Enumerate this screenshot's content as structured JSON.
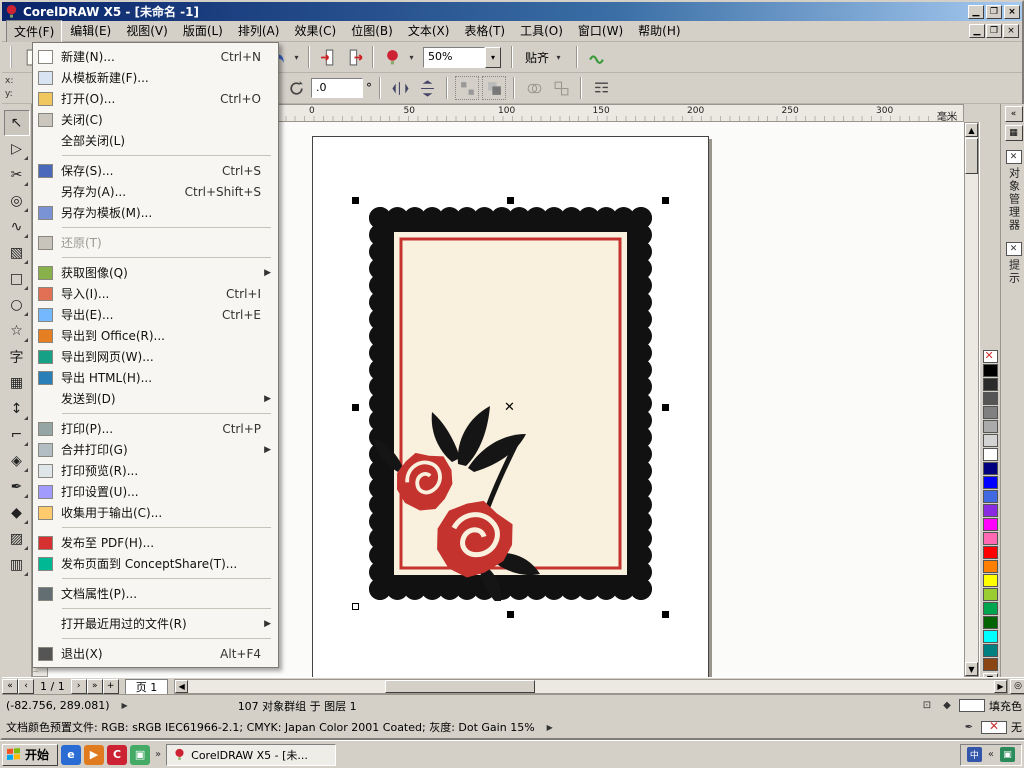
{
  "window": {
    "title": "CorelDRAW X5 - [未命名 -1]"
  },
  "menubar": {
    "items": [
      "文件(F)",
      "编辑(E)",
      "视图(V)",
      "版面(L)",
      "排列(A)",
      "效果(C)",
      "位图(B)",
      "文本(X)",
      "表格(T)",
      "工具(O)",
      "窗口(W)",
      "帮助(H)"
    ]
  },
  "file_menu": {
    "items": [
      {
        "label": "新建(N)...",
        "shortcut": "Ctrl+N",
        "icon": "new-doc-icon"
      },
      {
        "label": "从模板新建(F)...",
        "icon": "new-from-template-icon"
      },
      {
        "label": "打开(O)...",
        "shortcut": "Ctrl+O",
        "icon": "open-folder-icon"
      },
      {
        "label": "关闭(C)",
        "icon": "close-doc-icon"
      },
      {
        "label": "全部关闭(L)"
      },
      {
        "type": "separator"
      },
      {
        "label": "保存(S)...",
        "shortcut": "Ctrl+S",
        "icon": "save-icon"
      },
      {
        "label": "另存为(A)...",
        "shortcut": "Ctrl+Shift+S"
      },
      {
        "label": "另存为模板(M)...",
        "icon": "save-template-icon"
      },
      {
        "type": "separator"
      },
      {
        "label": "还原(T)",
        "disabled": true,
        "icon": "revert-icon"
      },
      {
        "type": "separator"
      },
      {
        "label": "获取图像(Q)",
        "submenu": true,
        "icon": "acquire-image-icon"
      },
      {
        "label": "导入(I)...",
        "shortcut": "Ctrl+I",
        "icon": "import-icon"
      },
      {
        "label": "导出(E)...",
        "shortcut": "Ctrl+E",
        "icon": "export-icon"
      },
      {
        "label": "导出到 Office(R)...",
        "icon": "export-office-icon"
      },
      {
        "label": "导出到网页(W)...",
        "icon": "export-web-icon"
      },
      {
        "label": "导出 HTML(H)...",
        "icon": "export-html-icon"
      },
      {
        "label": "发送到(D)",
        "submenu": true
      },
      {
        "type": "separator"
      },
      {
        "label": "打印(P)...",
        "shortcut": "Ctrl+P",
        "icon": "print-icon"
      },
      {
        "label": "合并打印(G)",
        "submenu": true,
        "icon": "merge-print-icon"
      },
      {
        "label": "打印预览(R)...",
        "icon": "print-preview-icon"
      },
      {
        "label": "打印设置(U)...",
        "icon": "print-setup-icon"
      },
      {
        "label": "收集用于输出(C)...",
        "icon": "collect-output-icon"
      },
      {
        "type": "separator"
      },
      {
        "label": "发布至 PDF(H)...",
        "icon": "pdf-icon"
      },
      {
        "label": "发布页面到 ConceptShare(T)...",
        "icon": "conceptshare-icon"
      },
      {
        "type": "separator"
      },
      {
        "label": "文档属性(P)...",
        "icon": "doc-properties-icon"
      },
      {
        "type": "separator"
      },
      {
        "label": "打开最近用过的文件(R)",
        "submenu": true
      },
      {
        "type": "separator"
      },
      {
        "label": "退出(X)",
        "shortcut": "Alt+F4",
        "icon": "exit-icon"
      }
    ]
  },
  "toolbar": {
    "zoom_value": "50%",
    "snap_label": "贴齐"
  },
  "property_bar": {
    "x_label": "x:",
    "y_label": "y:",
    "angle_value": ".0",
    "degree_symbol": "°"
  },
  "ruler": {
    "ticks": [
      "0",
      "50",
      "100",
      "150",
      "200",
      "250",
      "300"
    ],
    "unit": "毫米"
  },
  "toolbox": {
    "tools": [
      {
        "name": "pick-tool",
        "active": true
      },
      {
        "name": "shape-tool",
        "flyout": true
      },
      {
        "name": "crop-tool",
        "flyout": true
      },
      {
        "name": "zoom-tool",
        "flyout": true
      },
      {
        "name": "freehand-tool",
        "flyout": true
      },
      {
        "name": "smart-fill-tool",
        "flyout": true
      },
      {
        "name": "rectangle-tool",
        "flyout": true
      },
      {
        "name": "ellipse-tool",
        "flyout": true
      },
      {
        "name": "polygon-tool",
        "flyout": true
      },
      {
        "name": "text-tool"
      },
      {
        "name": "table-tool"
      },
      {
        "name": "dimension-tool",
        "flyout": true
      },
      {
        "name": "connector-tool",
        "flyout": true
      },
      {
        "name": "blend-tool",
        "flyout": true
      },
      {
        "name": "eyedropper-tool",
        "flyout": true
      },
      {
        "name": "outline-pen-tool",
        "flyout": true
      },
      {
        "name": "fill-tool",
        "flyout": true
      },
      {
        "name": "interactive-fill-tool",
        "flyout": true
      }
    ]
  },
  "palette": {
    "colors": [
      "none",
      "#000000",
      "#2b2b2b",
      "#555555",
      "#808080",
      "#aaaaaa",
      "#d4d4d4",
      "#ffffff",
      "#000080",
      "#0000ff",
      "#4169e1",
      "#8a2be2",
      "#ff00ff",
      "#ff69b4",
      "#ff0000",
      "#ff7f00",
      "#ffff00",
      "#9acd32",
      "#00a550",
      "#006400",
      "#00ffff",
      "#008080",
      "#8b4513"
    ]
  },
  "dockers": {
    "tabs": [
      {
        "label": "对象管理器"
      },
      {
        "label": "提示"
      }
    ]
  },
  "page_nav": {
    "pages_label": "1 / 1",
    "page_tab": "页 1"
  },
  "status": {
    "coords": "(-82.756, 289.081)",
    "object_info": "107 对象群组 于 图层 1",
    "color_profile": "文档颜色预置文件: RGB: sRGB IEC61966-2.1; CMYK: Japan Color 2001 Coated; 灰度: Dot Gain 15%",
    "fill_label": "填充色",
    "outline_label": "无"
  },
  "taskbar": {
    "start_label": "开始",
    "task_label": "CorelDRAW X5 - [未...",
    "quick_launch": [
      {
        "name": "ie-icon",
        "glyph": "e",
        "color": "#2b6cd4"
      },
      {
        "name": "media-player-icon",
        "glyph": "▶",
        "color": "#e07b20"
      },
      {
        "name": "corel-quicklaunch-icon",
        "glyph": "C",
        "color": "#cc2233"
      },
      {
        "name": "show-desktop-icon",
        "glyph": "▣",
        "color": "#44aa66"
      }
    ]
  },
  "artwork": {
    "stamp_bg": "#FAF0DE",
    "stamp_border": "#111111",
    "stamp_inner_border": "#C5332F",
    "rose_color": "#C5332F",
    "leaf_color": "#151515"
  }
}
